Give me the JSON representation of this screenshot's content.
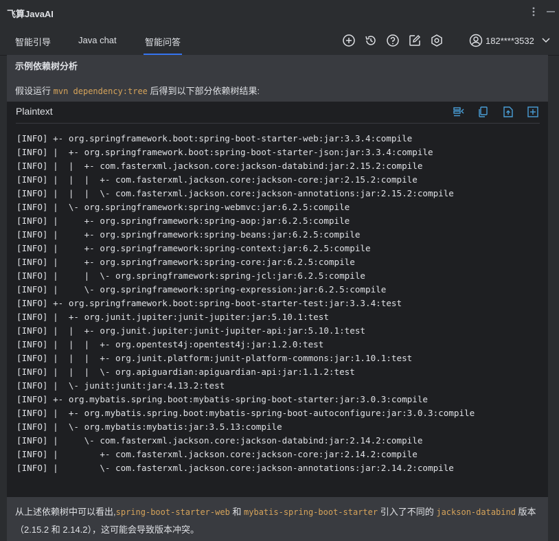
{
  "app": {
    "title": "飞算JavaAI",
    "menu_icon": "more-vertical-icon",
    "minimize_icon": "minimize-icon"
  },
  "tabs": [
    {
      "label": "智能引导",
      "active": false
    },
    {
      "label": "Java chat",
      "active": false
    },
    {
      "label": "智能问答",
      "active": true
    }
  ],
  "toolbar": {
    "icons": [
      "add-circle-icon",
      "history-icon",
      "help-icon",
      "edit-icon",
      "settings-icon"
    ]
  },
  "user": {
    "phone": "182****3532"
  },
  "colors": {
    "accent": "#3574f0",
    "inline_code": "#d5a35a",
    "code_icon": "#4a9fd8"
  },
  "message": {
    "section_title": "示例依赖树分析",
    "intro_prefix": "假设运行 ",
    "intro_code": "mvn dependency:tree",
    "intro_suffix": " 后得到以下部分依赖树结果:",
    "codeblock": {
      "language": "Plaintext",
      "actions": [
        "insert-left-icon",
        "copy-icon",
        "new-file-icon",
        "insert-icon"
      ],
      "lines": [
        "[INFO] +- org.springframework.boot:spring-boot-starter-web:jar:3.3.4:compile",
        "[INFO] |  +- org.springframework.boot:spring-boot-starter-json:jar:3.3.4:compile",
        "[INFO] |  |  +- com.fasterxml.jackson.core:jackson-databind:jar:2.15.2:compile",
        "[INFO] |  |  |  +- com.fasterxml.jackson.core:jackson-core:jar:2.15.2:compile",
        "[INFO] |  |  |  \\- com.fasterxml.jackson.core:jackson-annotations:jar:2.15.2:compile",
        "[INFO] |  \\- org.springframework:spring-webmvc:jar:6.2.5:compile",
        "[INFO] |     +- org.springframework:spring-aop:jar:6.2.5:compile",
        "[INFO] |     +- org.springframework:spring-beans:jar:6.2.5:compile",
        "[INFO] |     +- org.springframework:spring-context:jar:6.2.5:compile",
        "[INFO] |     +- org.springframework:spring-core:jar:6.2.5:compile",
        "[INFO] |     |  \\- org.springframework:spring-jcl:jar:6.2.5:compile",
        "[INFO] |     \\- org.springframework:spring-expression:jar:6.2.5:compile",
        "[INFO] +- org.springframework.boot:spring-boot-starter-test:jar:3.3.4:test",
        "[INFO] |  +- org.junit.jupiter:junit-jupiter:jar:5.10.1:test",
        "[INFO] |  |  +- org.junit.jupiter:junit-jupiter-api:jar:5.10.1:test",
        "[INFO] |  |  |  +- org.opentest4j:opentest4j:jar:1.2.0:test",
        "[INFO] |  |  |  +- org.junit.platform:junit-platform-commons:jar:1.10.1:test",
        "[INFO] |  |  |  \\- org.apiguardian:apiguardian-api:jar:1.1.2:test",
        "[INFO] |  \\- junit:junit:jar:4.13.2:test",
        "[INFO] +- org.mybatis.spring.boot:mybatis-spring-boot-starter:jar:3.0.3:compile",
        "[INFO] |  +- org.mybatis.spring.boot:mybatis-spring-boot-autoconfigure:jar:3.0.3:compile",
        "[INFO] |  \\- org.mybatis:mybatis:jar:3.5.13:compile",
        "[INFO] |     \\- com.fasterxml.jackson.core:jackson-databind:jar:2.14.2:compile",
        "[INFO] |        +- com.fasterxml.jackson.core:jackson-core:jar:2.14.2:compile",
        "[INFO] |        \\- com.fasterxml.jackson.core:jackson-annotations:jar:2.14.2:compile"
      ]
    },
    "outro": {
      "p1": "从上述依赖树中可以看出,",
      "c1": "spring-boot-starter-web",
      "p2": " 和 ",
      "c2": "mybatis-spring-boot-starter",
      "p3": " 引入了不同的 ",
      "c3": "jackson-databind",
      "p4": " 版本（2.15.2 和 2.14.2），这可能会导致版本冲突。"
    }
  }
}
